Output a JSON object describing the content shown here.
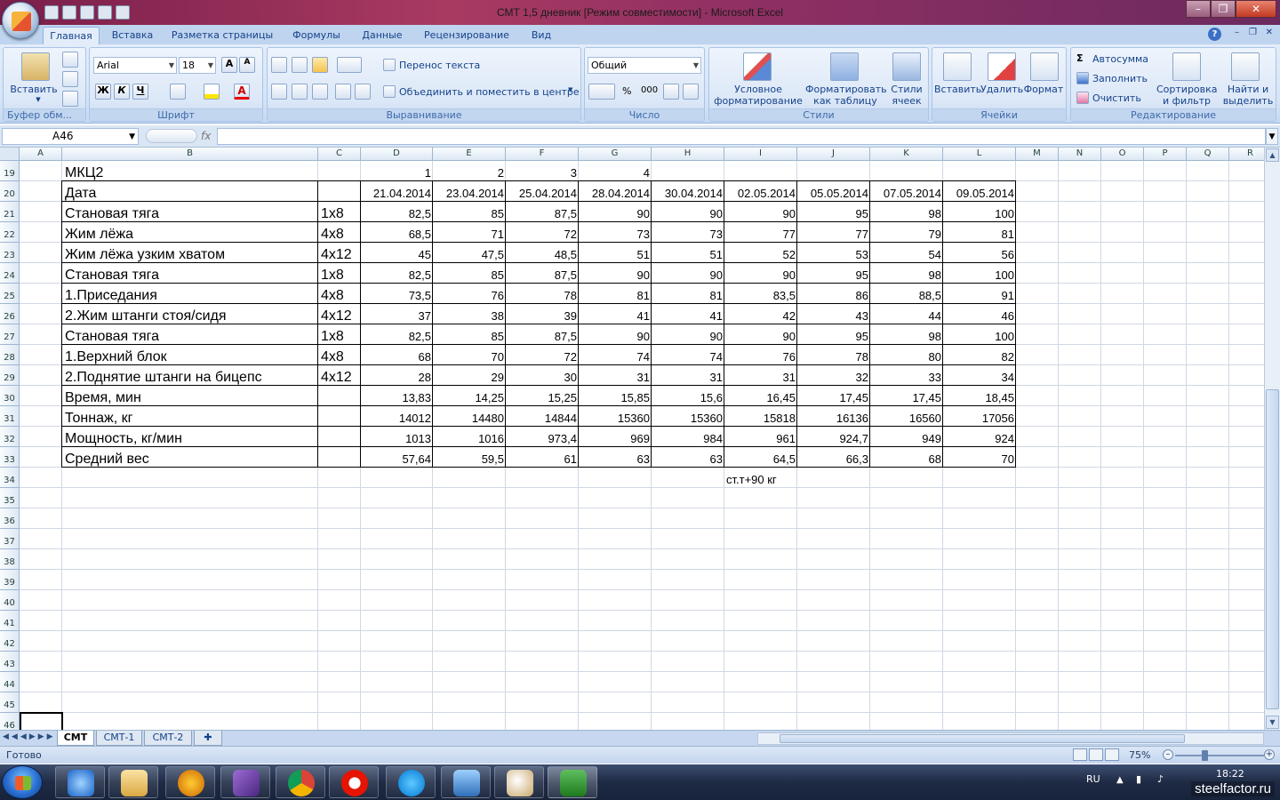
{
  "window": {
    "title": "СМТ 1,5 дневник  [Режим совместимости] - Microsoft Excel"
  },
  "ribbon_tabs": [
    "Главная",
    "Вставка",
    "Разметка страницы",
    "Формулы",
    "Данные",
    "Рецензирование",
    "Вид"
  ],
  "ribbon": {
    "clipboard": {
      "paste_label": "Вставить",
      "group_label": "Буфер обм..."
    },
    "font": {
      "font_name": "Arial",
      "font_size": "18",
      "bold": "Ж",
      "italic": "К",
      "underline": "Ч",
      "font_color_icon": "A",
      "group_label": "Шрифт"
    },
    "alignment": {
      "wrap_text": "Перенос текста",
      "merge_center": "Объединить и поместить в центре",
      "group_label": "Выравнивание"
    },
    "number": {
      "format": "Общий",
      "percent": "%",
      "thousands": "000",
      "group_label": "Число"
    },
    "styles": {
      "conditional": [
        "Условное",
        "форматирование"
      ],
      "format_table": [
        "Форматировать",
        "как таблицу"
      ],
      "cell_styles": [
        "Стили",
        "ячеек"
      ],
      "group_label": "Стили"
    },
    "cells": {
      "insert": "Вставить",
      "delete": "Удалить",
      "format": "Формат",
      "group_label": "Ячейки"
    },
    "editing": {
      "autosum": "Автосумма",
      "fill": "Заполнить",
      "clear": "Очистить",
      "sort": [
        "Сортировка",
        "и фильтр"
      ],
      "find": [
        "Найти и",
        "выделить"
      ],
      "group_label": "Редактирование"
    }
  },
  "formula_bar": {
    "name_box": "A46",
    "fx": "fx",
    "formula": ""
  },
  "columns": [
    "A",
    "B",
    "C",
    "D",
    "E",
    "F",
    "G",
    "H",
    "I",
    "J",
    "K",
    "L",
    "M",
    "N",
    "O",
    "P",
    "Q",
    "R"
  ],
  "rows": [
    "19",
    "20",
    "21",
    "22",
    "23",
    "24",
    "25",
    "26",
    "27",
    "28",
    "29",
    "30",
    "31",
    "32",
    "33",
    "34",
    "35",
    "36",
    "37",
    "38",
    "39",
    "40",
    "41",
    "42",
    "43",
    "44",
    "45",
    "46"
  ],
  "sheet": {
    "header_numbers": [
      "1",
      "2",
      "3",
      "4"
    ],
    "row19_label": "МКЦ2",
    "row20_label": "Дата",
    "dates": [
      "21.04.2014",
      "23.04.2014",
      "25.04.2014",
      "28.04.2014",
      "30.04.2014",
      "02.05.2014",
      "05.05.2014",
      "07.05.2014",
      "09.05.2014"
    ],
    "rows": [
      {
        "label": "Становая тяга",
        "sets": "1x8",
        "values": [
          "82,5",
          "85",
          "87,5",
          "90",
          "90",
          "90",
          "95",
          "98",
          "100"
        ]
      },
      {
        "label": "Жим лёжа",
        "sets": "4x8",
        "values": [
          "68,5",
          "71",
          "72",
          "73",
          "73",
          "77",
          "77",
          "79",
          "81"
        ]
      },
      {
        "label": "Жим лёжа узким хватом",
        "sets": "4x12",
        "values": [
          "45",
          "47,5",
          "48,5",
          "51",
          "51",
          "52",
          "53",
          "54",
          "56"
        ]
      },
      {
        "label": "Становая тяга",
        "sets": "1x8",
        "values": [
          "82,5",
          "85",
          "87,5",
          "90",
          "90",
          "90",
          "95",
          "98",
          "100"
        ]
      },
      {
        "label": "1.Приседания",
        "sets": "4x8",
        "values": [
          "73,5",
          "76",
          "78",
          "81",
          "81",
          "83,5",
          "86",
          "88,5",
          "91"
        ]
      },
      {
        "label": "2.Жим штанги стоя/сидя",
        "sets": "4x12",
        "values": [
          "37",
          "38",
          "39",
          "41",
          "41",
          "42",
          "43",
          "44",
          "46"
        ]
      },
      {
        "label": "Становая тяга",
        "sets": "1x8",
        "values": [
          "82,5",
          "85",
          "87,5",
          "90",
          "90",
          "90",
          "95",
          "98",
          "100"
        ]
      },
      {
        "label": "1.Верхний блок",
        "sets": "4x8",
        "values": [
          "68",
          "70",
          "72",
          "74",
          "74",
          "76",
          "78",
          "80",
          "82"
        ]
      },
      {
        "label": "2.Поднятие штанги на бицепс",
        "sets": "4x12",
        "values": [
          "28",
          "29",
          "30",
          "31",
          "31",
          "31",
          "32",
          "33",
          "34"
        ]
      },
      {
        "label": "Время, мин",
        "sets": "",
        "values": [
          "13,83",
          "14,25",
          "15,25",
          "15,85",
          "15,6",
          "16,45",
          "17,45",
          "17,45",
          "18,45"
        ]
      },
      {
        "label": "Тоннаж, кг",
        "sets": "",
        "values": [
          "14012",
          "14480",
          "14844",
          "15360",
          "15360",
          "15818",
          "16136",
          "16560",
          "17056"
        ]
      },
      {
        "label": "Мощность, кг/мин",
        "sets": "",
        "values": [
          "1013",
          "1016",
          "973,4",
          "969",
          "984",
          "961",
          "924,7",
          "949",
          "924"
        ]
      },
      {
        "label": "Средний вес",
        "sets": "",
        "values": [
          "57,64",
          "59,5",
          "61",
          "63",
          "63",
          "64,5",
          "66,3",
          "68",
          "70"
        ]
      }
    ],
    "note": "ст.т+90 кг"
  },
  "sheet_tabs": [
    "СМТ",
    "СМТ-1",
    "СМТ-2"
  ],
  "status": {
    "ready": "Готово",
    "zoom": "75%"
  },
  "taskbar": {
    "lang": "RU",
    "time": "18:22",
    "watermark": "steelfactor.ru"
  }
}
